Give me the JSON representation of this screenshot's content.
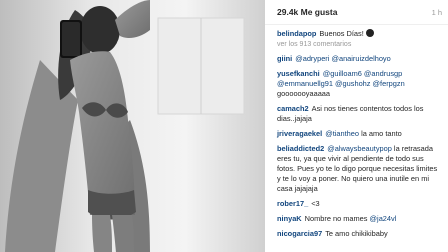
{
  "post": {
    "likes": "29.4k Me gusta",
    "time": "1 h",
    "caption": {
      "user": "belindapop",
      "text": "Buenos Días!",
      "emoji": "sun-emoji-icon"
    },
    "view_all": "ver los 913 comentarios"
  },
  "comments": [
    {
      "user": "giini",
      "mentions": "@adryperi @anairuizdelhoyo",
      "text": ""
    },
    {
      "user": "yusefkanchi",
      "mentions": "@guilloam6 @andrusgp @emmanuellg91 @gushohz @ferpgzn",
      "text": "gooooooyaaaaa"
    },
    {
      "user": "camach2",
      "mentions": "",
      "text": "Asi nos tienes contentos todos los dias..jajaja"
    },
    {
      "user": "jriveragaekel",
      "mentions": "@tiantheo",
      "text": "la amo tanto"
    },
    {
      "user": "beliaddicted2",
      "mentions": "@alwaysbeautypop",
      "text": "la retrasada eres tu, ya que vivir al pendiente de todo sus fotos. Pues yo te lo digo porque necesitas limites y te lo voy a poner. No quiero una inutile en mi casa jajajaja"
    },
    {
      "user": "rober17_",
      "mentions": "",
      "text": "<3"
    },
    {
      "user": "ninyaK",
      "mentions": "",
      "text": "Nombre no mames",
      "mentions_after": "@ja24vl"
    },
    {
      "user": "nicogarcia97",
      "mentions": "",
      "text": "Te amo chikikibaby"
    }
  ]
}
